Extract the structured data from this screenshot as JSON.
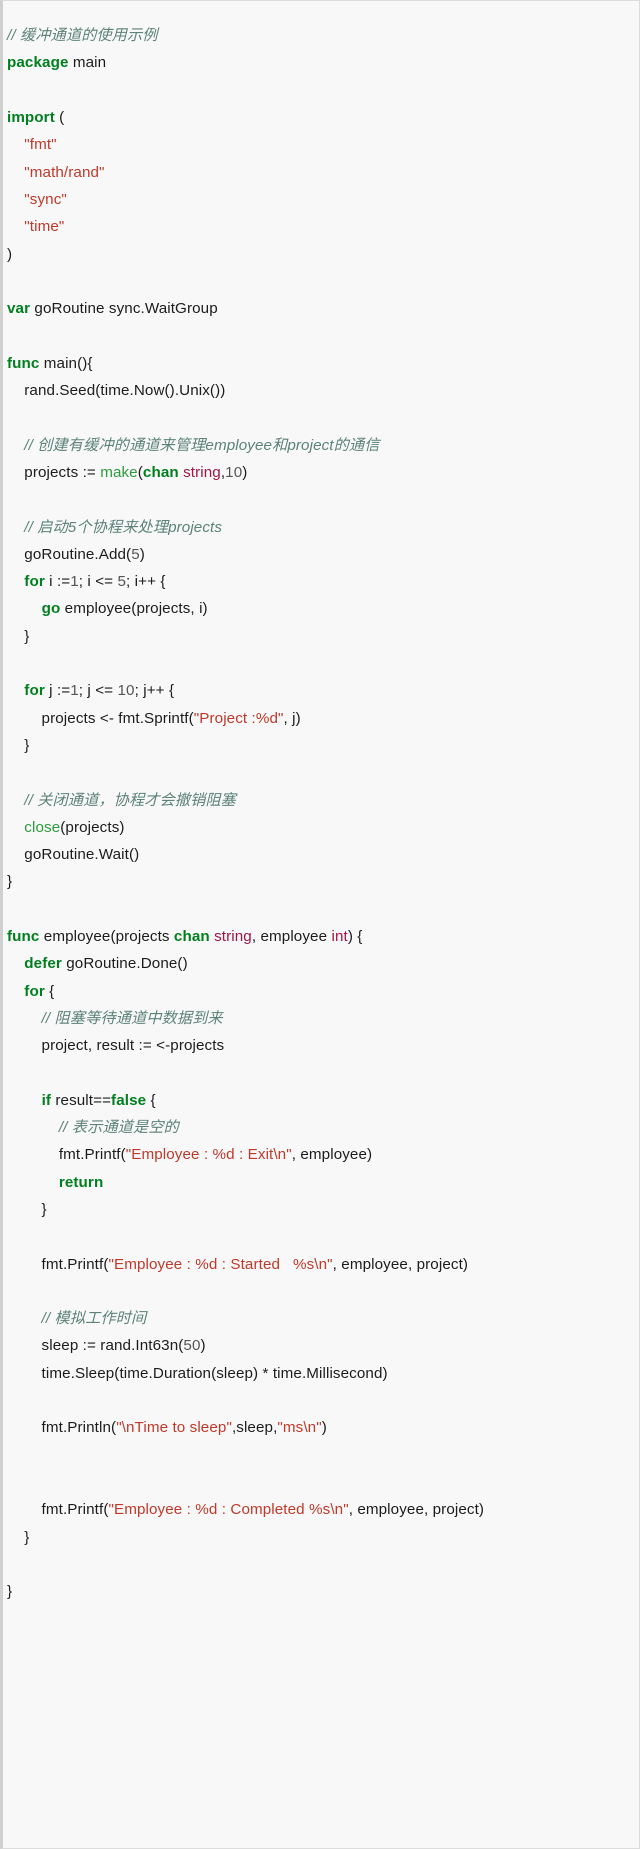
{
  "editor": {
    "language": "Go",
    "background": "#f8f8f8",
    "border_color": "#dcdcdc",
    "gutter_color": "#cfcfcf",
    "colors": {
      "plain": "#1c1c1c",
      "keyword": "#007f1f",
      "builtin": "#2c9a3e",
      "type": "#a31545",
      "string": "#c0392b",
      "number": "#555555",
      "comment": "#5c8279"
    }
  },
  "code": {
    "lines": [
      [
        {
          "t": "// 缓冲通道的使用示例",
          "c": "cmt"
        }
      ],
      [
        {
          "t": "package",
          "c": "kw"
        },
        {
          "t": " main",
          "c": "plain"
        }
      ],
      [],
      [
        {
          "t": "import",
          "c": "kw"
        },
        {
          "t": " (",
          "c": "punc"
        }
      ],
      [
        {
          "t": "    ",
          "c": "plain"
        },
        {
          "t": "\"fmt\"",
          "c": "str"
        }
      ],
      [
        {
          "t": "    ",
          "c": "plain"
        },
        {
          "t": "\"math/rand\"",
          "c": "str"
        }
      ],
      [
        {
          "t": "    ",
          "c": "plain"
        },
        {
          "t": "\"sync\"",
          "c": "str"
        }
      ],
      [
        {
          "t": "    ",
          "c": "plain"
        },
        {
          "t": "\"time\"",
          "c": "str"
        }
      ],
      [
        {
          "t": ")",
          "c": "punc"
        }
      ],
      [],
      [
        {
          "t": "var",
          "c": "kw"
        },
        {
          "t": " goRoutine sync.WaitGroup",
          "c": "plain"
        }
      ],
      [],
      [
        {
          "t": "func",
          "c": "kw"
        },
        {
          "t": " main(){",
          "c": "plain"
        }
      ],
      [
        {
          "t": "    rand.Seed(time.Now().Unix())",
          "c": "plain"
        }
      ],
      [],
      [
        {
          "t": "    // 创建有缓冲的通道来管理employee和project的通信",
          "c": "cmt"
        }
      ],
      [
        {
          "t": "    projects := ",
          "c": "plain"
        },
        {
          "t": "make",
          "c": "builtin"
        },
        {
          "t": "(",
          "c": "punc"
        },
        {
          "t": "chan",
          "c": "kw"
        },
        {
          "t": " ",
          "c": "plain"
        },
        {
          "t": "string",
          "c": "type"
        },
        {
          "t": ",",
          "c": "punc"
        },
        {
          "t": "10",
          "c": "num"
        },
        {
          "t": ")",
          "c": "punc"
        }
      ],
      [],
      [
        {
          "t": "    // 启动5个协程来处理projects",
          "c": "cmt"
        }
      ],
      [
        {
          "t": "    goRoutine.Add(",
          "c": "plain"
        },
        {
          "t": "5",
          "c": "num"
        },
        {
          "t": ")",
          "c": "punc"
        }
      ],
      [
        {
          "t": "    ",
          "c": "plain"
        },
        {
          "t": "for",
          "c": "kw"
        },
        {
          "t": " i :=",
          "c": "plain"
        },
        {
          "t": "1",
          "c": "num"
        },
        {
          "t": "; i <= ",
          "c": "plain"
        },
        {
          "t": "5",
          "c": "num"
        },
        {
          "t": "; i++ {",
          "c": "plain"
        }
      ],
      [
        {
          "t": "        ",
          "c": "plain"
        },
        {
          "t": "go",
          "c": "kw"
        },
        {
          "t": " employee(projects, i)",
          "c": "plain"
        }
      ],
      [
        {
          "t": "    }",
          "c": "punc"
        }
      ],
      [],
      [
        {
          "t": "    ",
          "c": "plain"
        },
        {
          "t": "for",
          "c": "kw"
        },
        {
          "t": " j :=",
          "c": "plain"
        },
        {
          "t": "1",
          "c": "num"
        },
        {
          "t": "; j <= ",
          "c": "plain"
        },
        {
          "t": "10",
          "c": "num"
        },
        {
          "t": "; j++ {",
          "c": "plain"
        }
      ],
      [
        {
          "t": "        projects <- fmt.Sprintf(",
          "c": "plain"
        },
        {
          "t": "\"Project :%d\"",
          "c": "str"
        },
        {
          "t": ", j)",
          "c": "plain"
        }
      ],
      [
        {
          "t": "    }",
          "c": "punc"
        }
      ],
      [],
      [
        {
          "t": "    // 关闭通道，协程才会撤销阻塞",
          "c": "cmt"
        }
      ],
      [
        {
          "t": "    ",
          "c": "plain"
        },
        {
          "t": "close",
          "c": "builtin"
        },
        {
          "t": "(projects)",
          "c": "plain"
        }
      ],
      [
        {
          "t": "    goRoutine.Wait()",
          "c": "plain"
        }
      ],
      [
        {
          "t": "}",
          "c": "punc"
        }
      ],
      [],
      [
        {
          "t": "func",
          "c": "kw"
        },
        {
          "t": " employee(projects ",
          "c": "plain"
        },
        {
          "t": "chan",
          "c": "kw"
        },
        {
          "t": " ",
          "c": "plain"
        },
        {
          "t": "string",
          "c": "type"
        },
        {
          "t": ", employee ",
          "c": "plain"
        },
        {
          "t": "int",
          "c": "type"
        },
        {
          "t": ") {",
          "c": "plain"
        }
      ],
      [
        {
          "t": "    ",
          "c": "plain"
        },
        {
          "t": "defer",
          "c": "kw"
        },
        {
          "t": " goRoutine.Done()",
          "c": "plain"
        }
      ],
      [
        {
          "t": "    ",
          "c": "plain"
        },
        {
          "t": "for",
          "c": "kw"
        },
        {
          "t": " {",
          "c": "plain"
        }
      ],
      [
        {
          "t": "        // 阻塞等待通道中数据到来",
          "c": "cmt"
        }
      ],
      [
        {
          "t": "        project, result := <-projects",
          "c": "plain"
        }
      ],
      [],
      [
        {
          "t": "        ",
          "c": "plain"
        },
        {
          "t": "if",
          "c": "kw"
        },
        {
          "t": " result==",
          "c": "plain"
        },
        {
          "t": "false",
          "c": "kw"
        },
        {
          "t": " {",
          "c": "plain"
        }
      ],
      [
        {
          "t": "            // 表示通道是空的",
          "c": "cmt"
        }
      ],
      [
        {
          "t": "            fmt.Printf(",
          "c": "plain"
        },
        {
          "t": "\"Employee : %d : Exit\\n\"",
          "c": "str"
        },
        {
          "t": ", employee)",
          "c": "plain"
        }
      ],
      [
        {
          "t": "            ",
          "c": "plain"
        },
        {
          "t": "return",
          "c": "kw"
        }
      ],
      [
        {
          "t": "        }",
          "c": "punc"
        }
      ],
      [],
      [
        {
          "t": "        fmt.Printf(",
          "c": "plain"
        },
        {
          "t": "\"Employee : %d : Started   %s\\n\"",
          "c": "str"
        },
        {
          "t": ", employee, project)",
          "c": "plain"
        }
      ],
      [],
      [
        {
          "t": "        // 模拟工作时间",
          "c": "cmt"
        }
      ],
      [
        {
          "t": "        sleep := rand.Int63n(",
          "c": "plain"
        },
        {
          "t": "50",
          "c": "num"
        },
        {
          "t": ")",
          "c": "punc"
        }
      ],
      [
        {
          "t": "        time.Sleep(time.Duration(sleep) * time.Millisecond)",
          "c": "plain"
        }
      ],
      [],
      [
        {
          "t": "        fmt.Println(",
          "c": "plain"
        },
        {
          "t": "\"\\nTime to sleep\"",
          "c": "str"
        },
        {
          "t": ",sleep,",
          "c": "plain"
        },
        {
          "t": "\"ms\\n\"",
          "c": "str"
        },
        {
          "t": ")",
          "c": "punc"
        }
      ],
      [],
      [],
      [
        {
          "t": "        fmt.Printf(",
          "c": "plain"
        },
        {
          "t": "\"Employee : %d : Completed %s\\n\"",
          "c": "str"
        },
        {
          "t": ", employee, project)",
          "c": "plain"
        }
      ],
      [
        {
          "t": "    }",
          "c": "punc"
        }
      ],
      [],
      [
        {
          "t": "}",
          "c": "punc"
        }
      ]
    ]
  }
}
